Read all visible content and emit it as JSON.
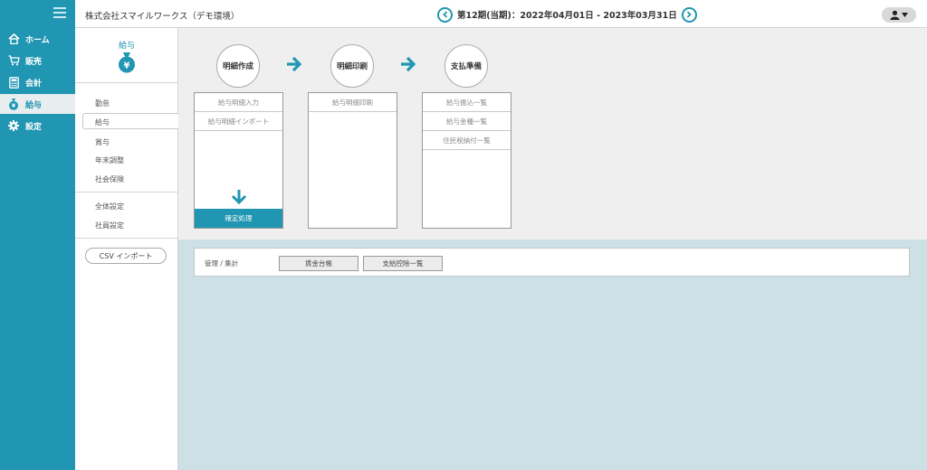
{
  "nav": {
    "items": [
      {
        "label": "ホーム",
        "icon": "home-icon"
      },
      {
        "label": "販売",
        "icon": "cart-icon"
      },
      {
        "label": "会計",
        "icon": "calculator-icon"
      },
      {
        "label": "給与",
        "icon": "money-bag-icon",
        "active": true
      },
      {
        "label": "設定",
        "icon": "gear-icon"
      }
    ]
  },
  "header": {
    "company": "株式会社スマイルワークス（デモ環境）",
    "period": "第12期(当期)：2022年04月01日 - 2023年03月31日"
  },
  "subnav": {
    "title": "給与",
    "items": [
      "勤怠",
      "給与",
      "賞与",
      "年末調整",
      "社会保険",
      "全体設定",
      "社員設定"
    ],
    "csv_button": "CSV インポート"
  },
  "flow": {
    "steps": [
      {
        "title": "明細作成",
        "items": [
          "給与明細入力",
          "給与明細インポート"
        ],
        "action": "確定処理"
      },
      {
        "title": "明細印刷",
        "items": [
          "給与明細印刷"
        ]
      },
      {
        "title": "支払準備",
        "items": [
          "給与振込一覧",
          "給与金種一覧",
          "住民税納付一覧"
        ]
      }
    ]
  },
  "management": {
    "label": "管理 / 集計",
    "buttons": [
      "賃金台帳",
      "支給控除一覧"
    ]
  },
  "colors": {
    "accent": "#2196b2",
    "flow_bg": "#efefef",
    "bottom_bg": "#cde0e6"
  }
}
